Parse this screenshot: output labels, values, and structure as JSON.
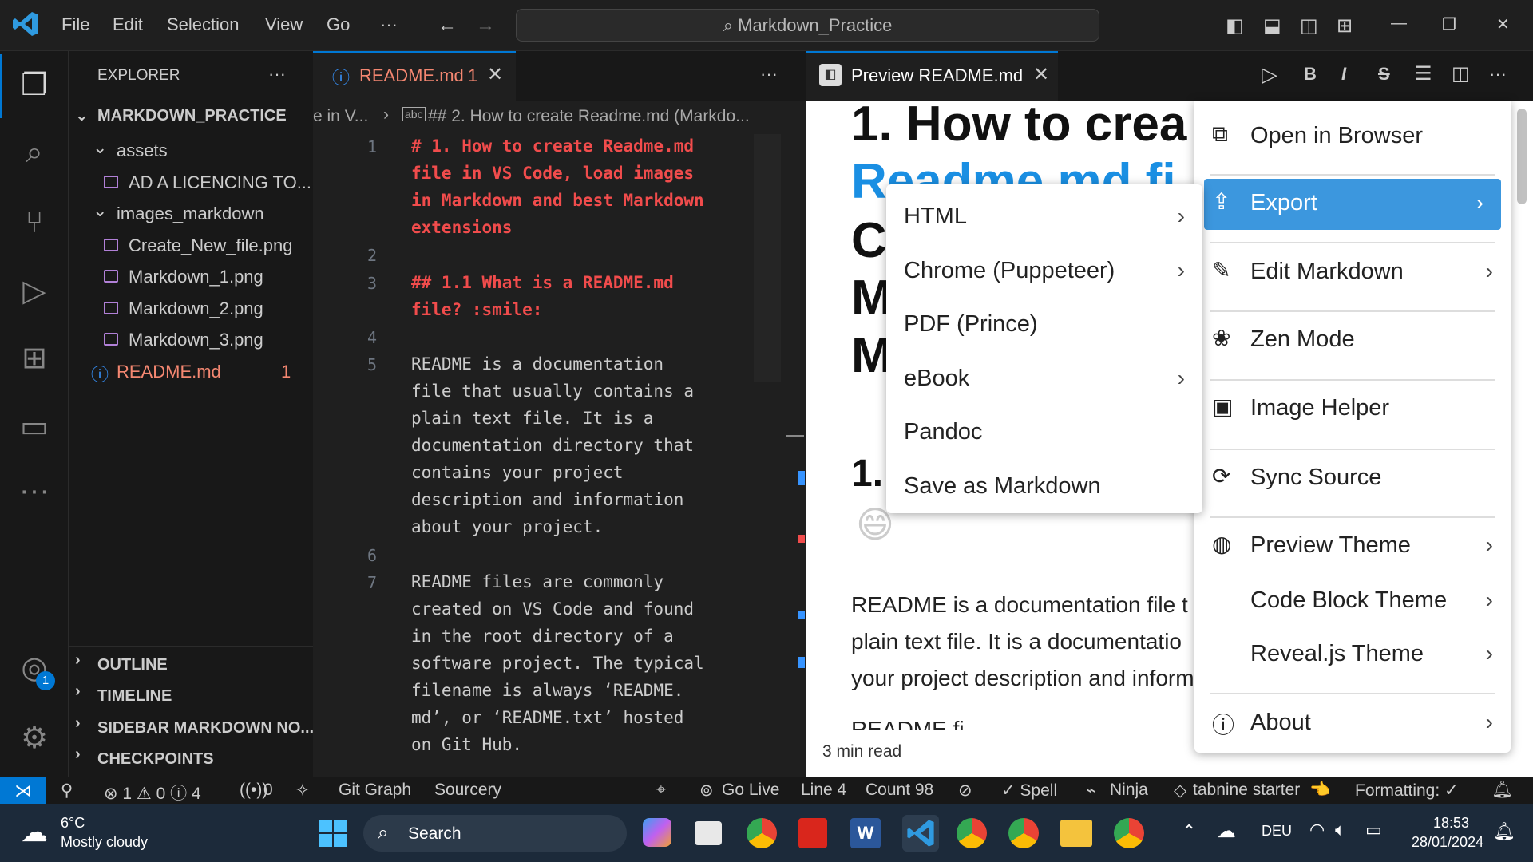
{
  "titlebar": {
    "menus": [
      "File",
      "Edit",
      "Selection",
      "View",
      "Go"
    ],
    "more": "···",
    "search_text": "Markdown_Practice",
    "minimize": "—",
    "restore": "❐",
    "close": "✕"
  },
  "sidebar": {
    "title": "EXPLORER",
    "more": "···",
    "project": "MARKDOWN_PRACTICE",
    "items": [
      {
        "label": "assets",
        "type": "folder"
      },
      {
        "label": "AD A LICENCING TO...",
        "type": "file"
      },
      {
        "label": "images_markdown",
        "type": "folder"
      },
      {
        "label": "Create_New_file.png",
        "type": "file"
      },
      {
        "label": "Markdown_1.png",
        "type": "file"
      },
      {
        "label": "Markdown_2.png",
        "type": "file"
      },
      {
        "label": "Markdown_3.png",
        "type": "file"
      },
      {
        "label": "README.md",
        "type": "readme",
        "badge": "1"
      }
    ],
    "sections": [
      "OUTLINE",
      "TIMELINE",
      "SIDEBAR MARKDOWN NO...",
      "CHECKPOINTS"
    ]
  },
  "editor": {
    "tab_label": "README.md",
    "tab_badge": "1",
    "breadcrumb_left": "e in V...",
    "breadcrumb": "## 2. How to create Readme.md (Markdo...",
    "more": "···",
    "lines": [
      {
        "n": "1",
        "text": "# 1. How to create Readme.md",
        "style": "h1"
      },
      {
        "n": "",
        "text": "file in VS Code, load images",
        "style": "h1"
      },
      {
        "n": "",
        "text": "in Markdown and best Markdown",
        "style": "h1"
      },
      {
        "n": "",
        "text": "extensions",
        "style": "h1"
      },
      {
        "n": "2",
        "text": "",
        "style": "text"
      },
      {
        "n": "3",
        "text": "## 1.1 What is a README.md",
        "style": "h1"
      },
      {
        "n": "",
        "text": "file? :smile:",
        "style": "h1"
      },
      {
        "n": "4",
        "text": "",
        "style": "text"
      },
      {
        "n": "5",
        "text": "README is a documentation",
        "style": "text"
      },
      {
        "n": "",
        "text": "file that usually contains a",
        "style": "text"
      },
      {
        "n": "",
        "text": "plain text file. It is a",
        "style": "text"
      },
      {
        "n": "",
        "text": "documentation directory that",
        "style": "text"
      },
      {
        "n": "",
        "text": "contains your project",
        "style": "text"
      },
      {
        "n": "",
        "text": "description and information",
        "style": "text"
      },
      {
        "n": "",
        "text": "about your project.",
        "style": "text"
      },
      {
        "n": "6",
        "text": "",
        "style": "text"
      },
      {
        "n": "7",
        "text": "README files are commonly",
        "style": "text"
      },
      {
        "n": "",
        "text": "created on VS Code and found",
        "style": "text"
      },
      {
        "n": "",
        "text": "in the root directory of a",
        "style": "text"
      },
      {
        "n": "",
        "text": "software project. The typical",
        "style": "text"
      },
      {
        "n": "",
        "text": "filename is always ‘README.",
        "style": "text"
      },
      {
        "n": "",
        "text": "md’, or ‘README.txt’ hosted",
        "style": "text"
      },
      {
        "n": "",
        "text": "on Git Hub.",
        "style": "text"
      }
    ]
  },
  "preview": {
    "tab_label": "Preview README.md",
    "toolbar": {
      "play": "▷",
      "bold": "B",
      "italic": "I",
      "strike": "S",
      "list": "☰",
      "split": "◫",
      "more": "···"
    },
    "h1_line1": "1. How to crea",
    "h1_line2": "Readme.md fi",
    "h1_c": "C",
    "h1_m1": "M",
    "h1_m2": "M",
    "h2_prefix": "1.",
    "emoji": "😄",
    "para_lines": [
      "README is a documentation file t",
      "plain text file. It is a documentatio",
      "your project description and inform",
      "README fi"
    ],
    "read_time": "3 min read"
  },
  "context_menu": {
    "items": [
      {
        "label": "Open in Browser",
        "icon": "external-link-icon",
        "glyph": "⧉",
        "submenu": false
      },
      {
        "label": "Export",
        "icon": "export-icon",
        "glyph": "⇪",
        "submenu": true,
        "active": true
      },
      {
        "label": "Edit Markdown",
        "icon": "pencil-icon",
        "glyph": "✎",
        "submenu": true
      },
      {
        "label": "Zen Mode",
        "icon": "lotus-icon",
        "glyph": "❀",
        "submenu": false
      },
      {
        "label": "Image Helper",
        "icon": "image-icon",
        "glyph": "▣",
        "submenu": false
      },
      {
        "label": "Sync Source",
        "icon": "sync-icon",
        "glyph": "⟳",
        "submenu": false
      },
      {
        "label": "Preview Theme",
        "icon": "palette-icon",
        "glyph": "◍",
        "submenu": true
      },
      {
        "label": "Code Block Theme",
        "icon": "",
        "glyph": "",
        "submenu": true
      },
      {
        "label": "Reveal.js Theme",
        "icon": "",
        "glyph": "",
        "submenu": true
      },
      {
        "label": "About",
        "icon": "info-icon",
        "glyph": "ⓘ",
        "submenu": true
      }
    ]
  },
  "export_submenu": {
    "items": [
      {
        "label": "HTML",
        "submenu": true
      },
      {
        "label": "Chrome (Puppeteer)",
        "submenu": true
      },
      {
        "label": "PDF (Prince)",
        "submenu": false
      },
      {
        "label": "eBook",
        "submenu": true
      },
      {
        "label": "Pandoc",
        "submenu": false
      },
      {
        "label": "Save as Markdown",
        "submenu": false
      }
    ]
  },
  "statusbar": {
    "problems": "⊗ 1 ⚠ 0 ⓘ 4",
    "ports": "0",
    "git_graph": "Git Graph",
    "sourcery": "Sourcery",
    "go_live": "Go Live",
    "line": "Line 4",
    "count": "Count 98",
    "spell": "✓ Spell",
    "ninja": "Ninja",
    "tabnine": "tabnine starter",
    "formatting": "Formatting: ✓"
  },
  "taskbar": {
    "weather_temp": "6°C",
    "weather_desc": "Mostly cloudy",
    "search": "Search",
    "lang": "DEU",
    "time": "18:53",
    "date": "28/01/2024"
  },
  "colors": {
    "accent": "#0078d4",
    "export_highlight": "#3c97de",
    "heading_red": "#f14c4c",
    "preview_link": "#1a8fe3"
  }
}
